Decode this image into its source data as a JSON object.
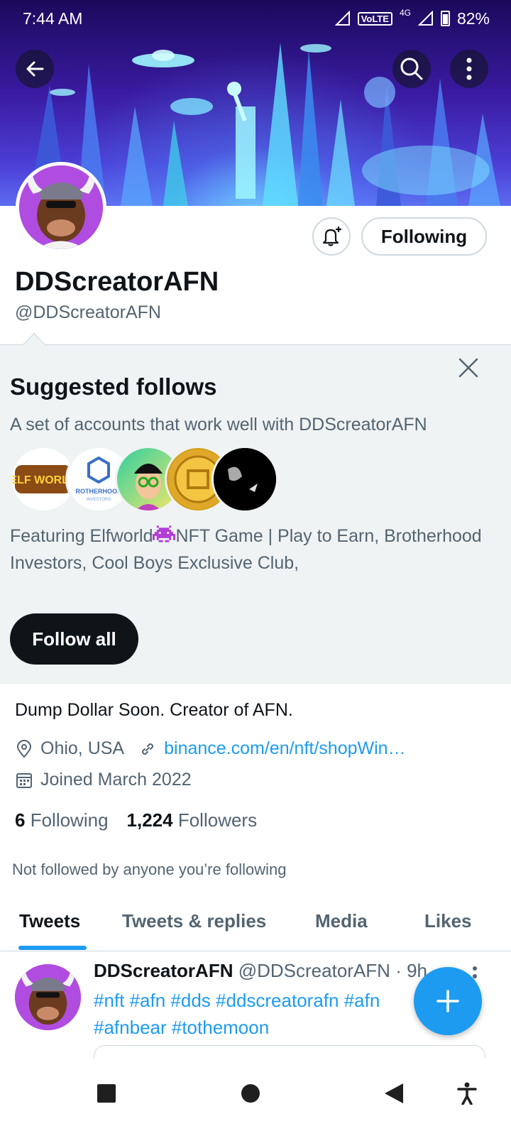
{
  "status_bar": {
    "time": "7:44 AM",
    "volte": "VoLTE",
    "network": "4G",
    "battery": "82%"
  },
  "profile": {
    "display_name": "DDScreatorAFN",
    "handle": "@DDScreatorAFN",
    "following_button": "Following",
    "bio": "Dump Dollar Soon. Creator of AFN.",
    "location": "Ohio, USA",
    "website": "binance.com/en/nft/shopWin…",
    "joined": "Joined March 2022",
    "following_count": "6",
    "following_label": "Following",
    "followers_count": "1,224",
    "followers_label": "Followers",
    "not_followed": "Not followed by anyone you’re following"
  },
  "suggested": {
    "title": "Suggested follows",
    "subtitle": "A set of accounts that work well with DDScreatorAFN",
    "desc_part1": "Featuring Elfworld",
    "desc_part2": "NFT Game | Play to Earn, Brotherhood Investors, Cool Boys Exclusive Club,",
    "follow_all": "Follow all",
    "elf_logo_text": "ELF WORLD",
    "brotherhood_logo_text": "ROTHERHOOD",
    "brotherhood_logo_sub": "INVESTORS"
  },
  "tabs": [
    {
      "label": "Tweets"
    },
    {
      "label": "Tweets & replies"
    },
    {
      "label": "Media"
    },
    {
      "label": "Likes"
    }
  ],
  "tweet": {
    "name": "DDScreatorAFN",
    "handle": "@DDScreatorAFN",
    "time_fragment": "· 9h",
    "text": "#nft #afn #dds #ddscreatorafn #afn #afnbear #tothemoon"
  },
  "icons": {
    "back": "back-arrow-icon",
    "search": "search-icon",
    "more": "more-vertical-icon",
    "bell": "bell-plus-icon",
    "close": "close-icon",
    "location": "location-pin-icon",
    "link": "link-icon",
    "calendar": "calendar-icon",
    "compose": "plus-icon"
  },
  "colors": {
    "accent": "#1d9bf0",
    "text": "#0f1419",
    "secondary": "#536471",
    "panel": "#eff3f4"
  }
}
